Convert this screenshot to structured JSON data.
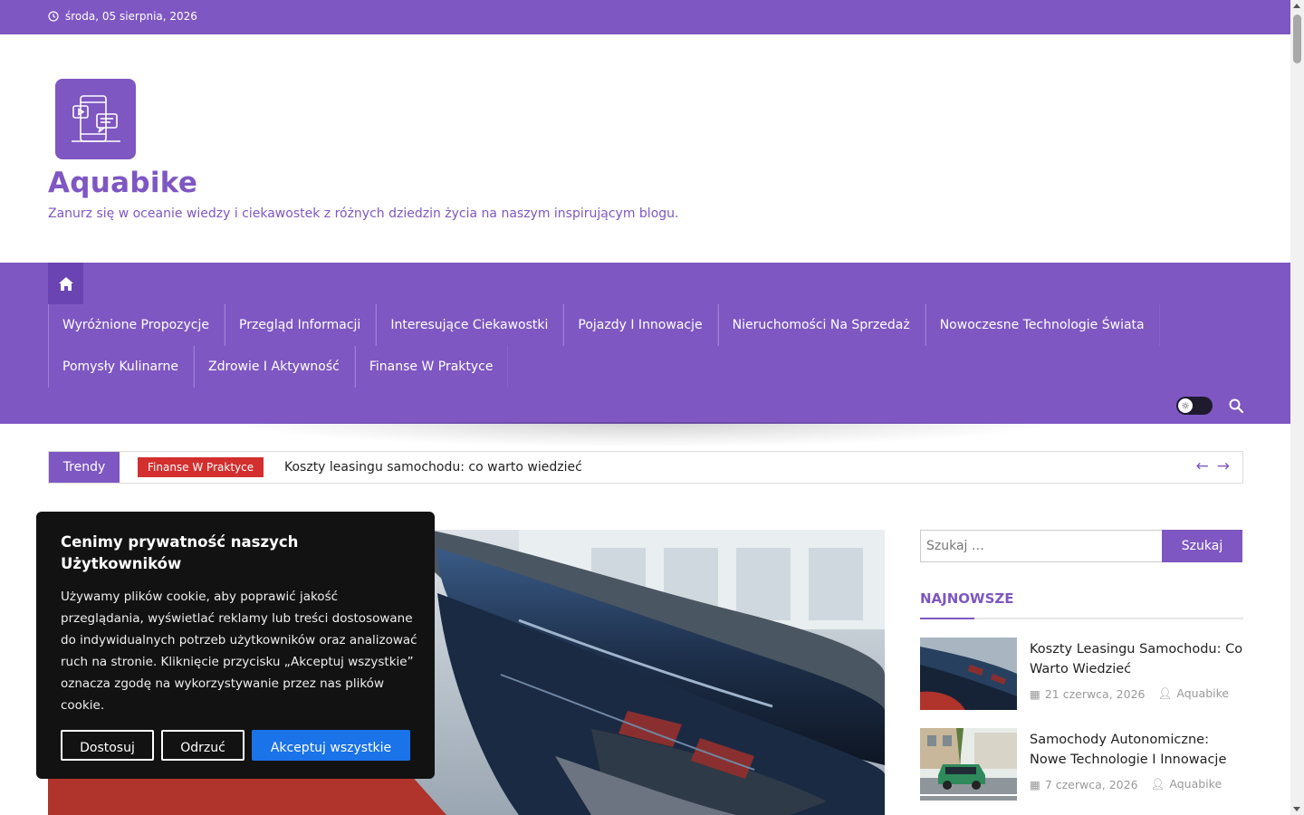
{
  "topbar": {
    "date": "środa, 05 sierpnia, 2026",
    "clock_icon": "clock-icon"
  },
  "site": {
    "logo_icon": "devices-chat-icon",
    "title": "Aquabike",
    "tagline": "Zanurz się w oceanie wiedzy i ciekawostek z różnych dziedzin życia na naszym inspirującym blogu."
  },
  "nav": {
    "home_icon": "home-icon",
    "row1": [
      "Wyróżnione Propozycje",
      "Przegląd Informacji",
      "Interesujące Ciekawostki",
      "Pojazdy I Innowacje",
      "Nieruchomości Na Sprzedaż",
      "Nowoczesne Technologie Świata"
    ],
    "row2": [
      "Pomysły Kulinarne",
      "Zdrowie I Aktywność",
      "Finanse W Praktyce"
    ],
    "theme_toggle_icon": "sun-icon",
    "search_icon": "search-icon"
  },
  "trending": {
    "label": "Trendy",
    "category": "Finanse W Praktyce",
    "headline": "Koszty leasingu samochodu: co warto wiedzieć",
    "prev": "←",
    "next": "→"
  },
  "sidebar": {
    "search_placeholder": "Szukaj …",
    "search_button": "Szukaj",
    "widget_title": "NAJNOWSZE",
    "posts": [
      {
        "title": "Koszty Leasingu Samochodu: Co Warto Wiedzieć",
        "date": "21 czerwca, 2026",
        "author": "Aquabike"
      },
      {
        "title": "Samochody Autonomiczne: Nowe Technologie I Innowacje",
        "date": "7 czerwca, 2026",
        "author": "Aquabike"
      }
    ]
  },
  "cookie": {
    "title": "Cenimy prywatność naszych Użytkowników",
    "body": "Używamy plików cookie, aby poprawić jakość przeglądania, wyświetlać reklamy lub treści dostosowane do indywidualnych potrzeb użytkowników oraz analizować ruch na stronie. Kliknięcie przycisku „Akceptuj wszystkie” oznacza zgodę na wykorzystywanie przez nas plików cookie.",
    "customize": "Dostosuj",
    "reject": "Odrzuć",
    "accept": "Akceptuj wszystkie"
  },
  "colors": {
    "brand": "#7e57c2",
    "badge": "#d32f2f",
    "accept": "#1a73e8",
    "dialog": "#121212"
  }
}
